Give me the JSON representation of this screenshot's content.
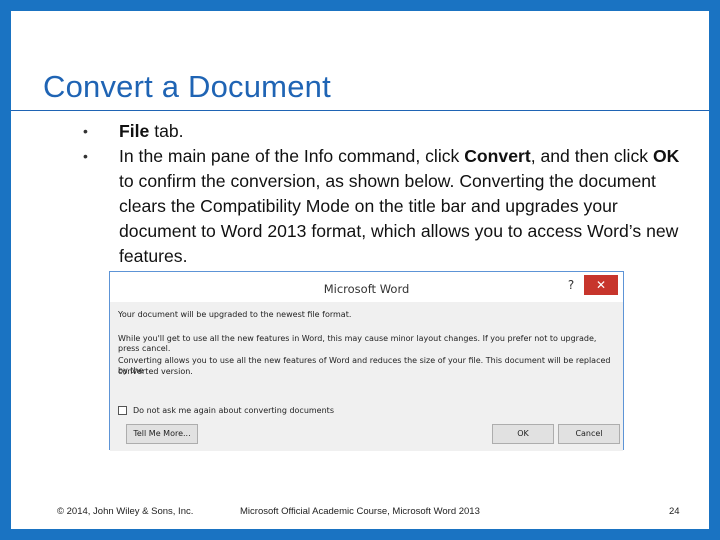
{
  "slide": {
    "title": "Convert a Document",
    "bullets": [
      {
        "parts": [
          {
            "bold": "File"
          },
          {
            "text": " tab."
          }
        ]
      },
      {
        "parts": [
          {
            "text": "In the main pane of the Info command, click "
          },
          {
            "bold": "Convert"
          },
          {
            "text": ", and then click "
          },
          {
            "bold": "OK"
          },
          {
            "text": " to confirm the conversion, as shown below. Converting the document clears the Compatibility Mode on the title bar and upgrades your document to Word 2013 format, which allows you to access Word’s new features."
          }
        ]
      }
    ],
    "bullet_glyph": "•"
  },
  "dialog": {
    "title": "Microsoft Word",
    "help_label": "?",
    "close_label": "✕",
    "line1": "Your document will be upgraded to the newest file format.",
    "line2": "While you'll get to use all the new features in Word, this may cause minor layout changes. If you prefer not to upgrade, press cancel.",
    "line3a": "Converting allows you to use all the new features of Word and reduces the size of your file. This document will be replaced by the",
    "line3b": "converted version.",
    "checkbox_label": "Do not ask me again about converting documents",
    "tell_me_more": "Tell Me More...",
    "ok": "OK",
    "cancel": "Cancel"
  },
  "footer": {
    "copyright": "© 2014, John Wiley & Sons, Inc.",
    "course": "Microsoft Official Academic Course, Microsoft Word 2013",
    "page": "24"
  },
  "colors": {
    "frame": "#1a73c2",
    "title": "#1f64b4",
    "close_button": "#c7352c"
  }
}
